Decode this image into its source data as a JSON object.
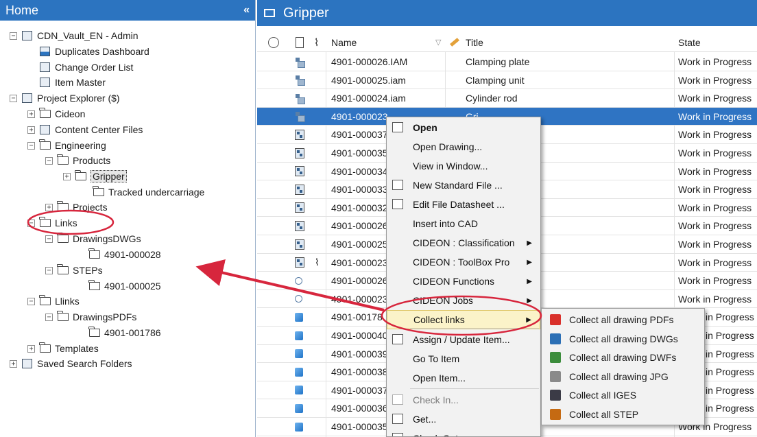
{
  "left_pane": {
    "title": "Home",
    "collapse_glyph": "«",
    "tree": [
      {
        "label": "CDN_Vault_EN - Admin",
        "icon": "vault-icon",
        "expander": "−"
      },
      {
        "label": "Duplicates Dashboard",
        "icon": "dashboard-icon",
        "expander": ""
      },
      {
        "label": "Change Order List",
        "icon": "list-icon",
        "expander": ""
      },
      {
        "label": "Item Master",
        "icon": "item-master-icon",
        "expander": ""
      },
      {
        "label": "Project Explorer ($)",
        "icon": "project-explorer-icon",
        "expander": "−"
      },
      {
        "label": "Cideon",
        "icon": "folder-icon",
        "expander": "+"
      },
      {
        "label": "Content Center Files",
        "icon": "content-center-icon",
        "expander": "+"
      },
      {
        "label": "Engineering",
        "icon": "folder-icon",
        "expander": "−"
      },
      {
        "label": "Products",
        "icon": "folder-icon",
        "expander": "−"
      },
      {
        "label": "Gripper",
        "icon": "folder-icon",
        "expander": "+",
        "selected": true
      },
      {
        "label": "Tracked undercarriage",
        "icon": "folder-icon",
        "expander": ""
      },
      {
        "label": "Projects",
        "icon": "folder-icon",
        "expander": "+"
      },
      {
        "label": "Links",
        "icon": "folder-icon",
        "expander": "−"
      },
      {
        "label": "DrawingsDWGs",
        "icon": "folder-icon",
        "expander": "−"
      },
      {
        "label": "4901-000028",
        "icon": "folder-icon",
        "expander": ""
      },
      {
        "label": "STEPs",
        "icon": "folder-icon",
        "expander": "−"
      },
      {
        "label": "4901-000025",
        "icon": "folder-icon",
        "expander": ""
      },
      {
        "label": "Llinks",
        "icon": "folder-icon",
        "expander": "−"
      },
      {
        "label": "DrawingsPDFs",
        "icon": "folder-icon",
        "expander": "−"
      },
      {
        "label": "4901-001786",
        "icon": "folder-icon",
        "expander": ""
      },
      {
        "label": "Templates",
        "icon": "folder-icon",
        "expander": "+"
      },
      {
        "label": "Saved Search Folders",
        "icon": "saved-search-icon",
        "expander": "+"
      }
    ]
  },
  "right_pane": {
    "title": "Gripper",
    "columns": {
      "name": "Name",
      "sort_glyph": "▽",
      "title": "Title",
      "state": "State"
    },
    "rows": [
      {
        "name": "4901-000026.IAM",
        "title": "Clamping plate",
        "state": "Work in Progress",
        "icon": "assembly-icon",
        "attach": false
      },
      {
        "name": "4901-000025.iam",
        "title": "Clamping unit",
        "state": "Work in Progress",
        "icon": "assembly-icon",
        "attach": false
      },
      {
        "name": "4901-000024.iam",
        "title": "Cylinder rod",
        "state": "Work in Progress",
        "icon": "assembly-icon",
        "attach": false
      },
      {
        "name": "4901-000023",
        "title": "Gri",
        "state": "Work in Progress",
        "icon": "assembly-icon",
        "attach": false,
        "selected": true
      },
      {
        "name": "4901-000037",
        "title": "",
        "state": "Work in Progress",
        "icon": "drawing-icon",
        "attach": false
      },
      {
        "name": "4901-000035",
        "title": "",
        "state": "Work in Progress",
        "icon": "drawing-icon",
        "attach": false
      },
      {
        "name": "4901-000034",
        "title": "",
        "state": "Work in Progress",
        "icon": "drawing-icon",
        "attach": false
      },
      {
        "name": "4901-000033",
        "title": "",
        "state": "Work in Progress",
        "icon": "drawing-icon",
        "attach": false
      },
      {
        "name": "4901-000032",
        "title": "",
        "state": "Work in Progress",
        "icon": "drawing-icon",
        "attach": false
      },
      {
        "name": "4901-000026",
        "title": "",
        "state": "Work in Progress",
        "icon": "drawing-icon",
        "attach": false
      },
      {
        "name": "4901-000025",
        "title": "",
        "state": "Work in Progress",
        "icon": "drawing-icon",
        "attach": false
      },
      {
        "name": "4901-000023",
        "title": "",
        "state": "Work in Progress",
        "icon": "drawing-icon",
        "attach": true
      },
      {
        "name": "4901-000026",
        "title": "",
        "state": "Work in Progress",
        "icon": "link-file-icon",
        "attach": false
      },
      {
        "name": "4901-000023",
        "title": "",
        "state": "Work in Progress",
        "icon": "link-file-icon",
        "attach": false
      },
      {
        "name": "4901-00178",
        "title": "",
        "state": "in Progress",
        "icon": "part-icon",
        "attach": false
      },
      {
        "name": "4901-000040",
        "title": "",
        "state": "in Progress",
        "icon": "part-icon",
        "attach": false
      },
      {
        "name": "4901-000039",
        "title": "",
        "state": "in Progress",
        "icon": "part-icon",
        "attach": false
      },
      {
        "name": "4901-000038",
        "title": "",
        "state": "in Progress",
        "icon": "part-icon",
        "attach": false
      },
      {
        "name": "4901-000037",
        "title": "",
        "state": "in Progress",
        "icon": "part-icon",
        "attach": false
      },
      {
        "name": "4901-000036",
        "title": "",
        "state": "in Progress",
        "icon": "part-icon",
        "attach": false
      },
      {
        "name": "4901-000035",
        "title": "",
        "state": "Work in Progress",
        "icon": "part-icon",
        "attach": false
      }
    ]
  },
  "context_menu": {
    "items": [
      {
        "label": "Open",
        "bold": true,
        "icon": "open-folder-icon"
      },
      {
        "label": "Open Drawing...",
        "bold": false
      },
      {
        "label": "View in Window...",
        "bold": false
      },
      {
        "label": "New Standard File ...",
        "bold": false,
        "icon": "new-file-icon"
      },
      {
        "label": "Edit File Datasheet ...",
        "bold": false,
        "icon": "datasheet-icon"
      },
      {
        "label": "Insert into CAD",
        "bold": false
      },
      {
        "label": "CIDEON : Classification",
        "bold": false,
        "submenu": true
      },
      {
        "label": "CIDEON : ToolBox Pro",
        "bold": false,
        "submenu": true
      },
      {
        "label": "CIDEON Functions",
        "bold": false,
        "submenu": true
      },
      {
        "label": "CIDEON Jobs",
        "bold": false,
        "submenu": true
      },
      {
        "label": "Collect links",
        "bold": false,
        "submenu": true,
        "hover": true
      },
      {
        "label": "Assign / Update Item...",
        "bold": false,
        "icon": "assign-item-icon"
      },
      {
        "label": "Go To Item",
        "bold": false
      },
      {
        "label": "Open Item...",
        "bold": false
      },
      {
        "label": "Check In...",
        "bold": false,
        "disabled": true,
        "icon": "check-in-icon"
      },
      {
        "label": "Get...",
        "bold": false,
        "icon": "get-icon"
      },
      {
        "label": "Check Out",
        "bold": false,
        "icon": "check-out-icon"
      }
    ]
  },
  "submenu": {
    "items": [
      {
        "label": "Collect all drawing PDFs",
        "icon": "pdf-icon",
        "color": "#d9302b"
      },
      {
        "label": "Collect all drawing DWGs",
        "icon": "dwg-icon",
        "color": "#2b6fb5"
      },
      {
        "label": "Collect all drawing DWFs",
        "icon": "dwf-icon",
        "color": "#3c8d3c"
      },
      {
        "label": "Collect all drawing JPG",
        "icon": "jpg-icon",
        "color": "#8a8a8a"
      },
      {
        "label": "Collect all IGES",
        "icon": "iges-icon",
        "color": "#3b3b46"
      },
      {
        "label": "Collect all STEP",
        "icon": "step-icon",
        "color": "#c56a12"
      }
    ]
  },
  "colors": {
    "accent": "#2c74c0",
    "selection": "#2f74c3",
    "annotation": "#d7263d",
    "menu_hover": "#fbf3c9"
  }
}
